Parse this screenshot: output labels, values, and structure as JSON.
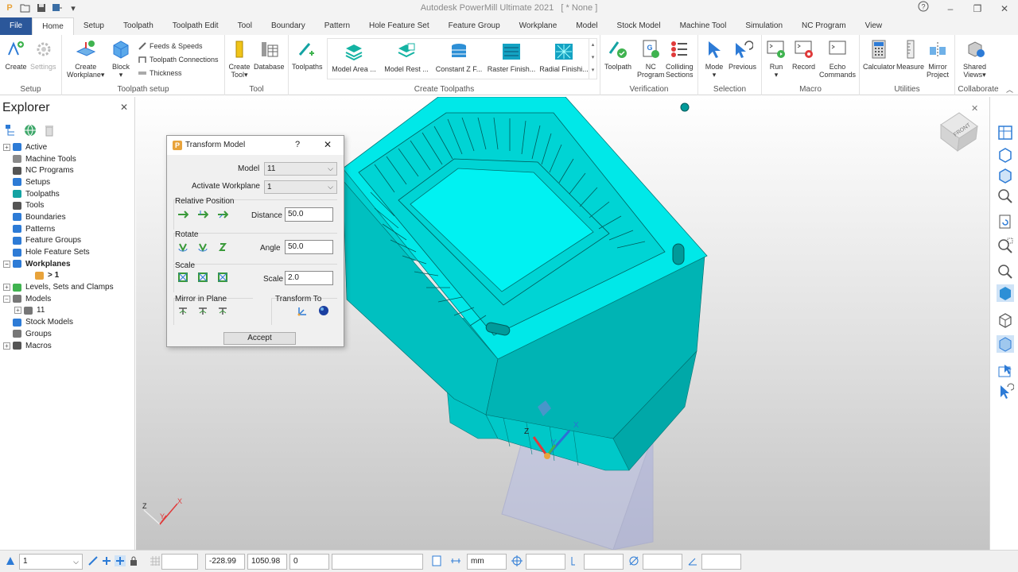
{
  "app": {
    "title": "Autodesk PowerMill Ultimate 2021",
    "document": "[ * None ]"
  },
  "tabs": [
    "File",
    "Home",
    "Setup",
    "Toolpath",
    "Toolpath Edit",
    "Tool",
    "Boundary",
    "Pattern",
    "Hole Feature Set",
    "Feature Group",
    "Workplane",
    "Model",
    "Stock Model",
    "Machine Tool",
    "Simulation",
    "NC Program",
    "View"
  ],
  "ribbon": {
    "setup": {
      "create": "Create",
      "settings": "Settings",
      "label": "Setup"
    },
    "toolpath_setup": {
      "create_workplane_1": "Create",
      "create_workplane_2": "Workplane",
      "block": "Block",
      "feeds": "Feeds & Speeds",
      "connections": "Toolpath Connections",
      "thickness": "Thickness",
      "label": "Toolpath setup"
    },
    "tool": {
      "create_tool_1": "Create",
      "create_tool_2": "Tool",
      "database": "Database",
      "label": "Tool"
    },
    "create_toolpaths": {
      "toolpaths": "Toolpaths",
      "items": [
        "Model Area ...",
        "Model Rest ...",
        "Constant Z F...",
        "Raster Finish...",
        "Radial Finishi..."
      ],
      "label": "Create Toolpaths"
    },
    "verification": {
      "toolpath": "Toolpath",
      "nc_program_1": "NC",
      "nc_program_2": "Program",
      "colliding_1": "Colliding",
      "colliding_2": "Sections",
      "label": "Verification"
    },
    "selection": {
      "mode": "Mode",
      "previous": "Previous",
      "label": "Selection"
    },
    "macro": {
      "run": "Run",
      "record": "Record",
      "echo_1": "Echo",
      "echo_2": "Commands",
      "label": "Macro"
    },
    "utilities": {
      "calculator": "Calculator",
      "measure": "Measure",
      "mirror_1": "Mirror",
      "mirror_2": "Project",
      "label": "Utilities"
    },
    "collaborate": {
      "shared_1": "Shared",
      "shared_2": "Views",
      "label": "Collaborate"
    }
  },
  "explorer": {
    "title": "Explorer",
    "nodes": [
      {
        "label": "Active",
        "expand": "+",
        "bold": false,
        "indent": 0,
        "icon": "play-icon"
      },
      {
        "label": "Machine Tools",
        "expand": "",
        "bold": false,
        "indent": 0,
        "icon": "machine-icon"
      },
      {
        "label": "NC Programs",
        "expand": "",
        "bold": false,
        "indent": 0,
        "icon": "nc-icon"
      },
      {
        "label": "Setups",
        "expand": "",
        "bold": false,
        "indent": 0,
        "icon": "setup-icon"
      },
      {
        "label": "Toolpaths",
        "expand": "",
        "bold": false,
        "indent": 0,
        "icon": "toolpath-icon"
      },
      {
        "label": "Tools",
        "expand": "",
        "bold": false,
        "indent": 0,
        "icon": "tool-icon"
      },
      {
        "label": "Boundaries",
        "expand": "",
        "bold": false,
        "indent": 0,
        "icon": "boundary-icon"
      },
      {
        "label": "Patterns",
        "expand": "",
        "bold": false,
        "indent": 0,
        "icon": "pattern-icon"
      },
      {
        "label": "Feature Groups",
        "expand": "",
        "bold": false,
        "indent": 0,
        "icon": "feature-icon"
      },
      {
        "label": "Hole Feature Sets",
        "expand": "",
        "bold": false,
        "indent": 0,
        "icon": "hole-icon"
      },
      {
        "label": "Workplanes",
        "expand": "−",
        "bold": true,
        "indent": 0,
        "icon": "workplane-icon"
      },
      {
        "label": "> 1",
        "expand": "",
        "bold": true,
        "indent": 2,
        "icon": "workplane-active-icon"
      },
      {
        "label": "Levels, Sets and Clamps",
        "expand": "+",
        "bold": false,
        "indent": 0,
        "icon": "levels-icon"
      },
      {
        "label": "Models",
        "expand": "−",
        "bold": false,
        "indent": 0,
        "icon": "models-icon"
      },
      {
        "label": "11",
        "expand": "+",
        "bold": false,
        "indent": 1,
        "icon": "model-icon"
      },
      {
        "label": "Stock Models",
        "expand": "",
        "bold": false,
        "indent": 0,
        "icon": "stock-icon"
      },
      {
        "label": "Groups",
        "expand": "",
        "bold": false,
        "indent": 0,
        "icon": "groups-icon"
      },
      {
        "label": "Macros",
        "expand": "+",
        "bold": false,
        "indent": 0,
        "icon": "macro-icon"
      }
    ]
  },
  "dialog": {
    "title": "Transform Model",
    "help": "?",
    "close": "✕",
    "model_label": "Model",
    "model_value": "11",
    "workplane_label": "Activate Workplane",
    "workplane_value": "1",
    "relpos_label": "Relative Position",
    "distance_label": "Distance",
    "distance_value": "50.0",
    "rotate_label": "Rotate",
    "angle_label": "Angle",
    "angle_value": "50.0",
    "scale_section": "Scale",
    "scale_label": "Scale",
    "scale_value": "2.0",
    "mirror_label": "Mirror in Plane",
    "transform_label": "Transform To",
    "accept": "Accept"
  },
  "viewport": {
    "axis_main": {
      "x": "X",
      "y": "Y",
      "z": "Z"
    },
    "axis_corner": {
      "x": "X",
      "y": "Y",
      "z": "Z"
    },
    "viewcube": "FRONT",
    "model_color": "#00e5e5"
  },
  "statusbar": {
    "workplane": "1",
    "x": "-228.99",
    "y": "1050.98",
    "z": "0",
    "units": "mm"
  }
}
